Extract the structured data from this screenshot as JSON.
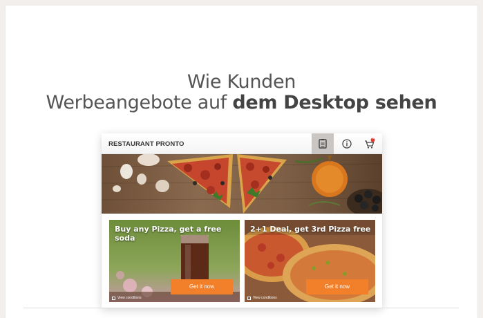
{
  "heading": {
    "line1": "Wie Kunden",
    "line2_regular": "Werbeangebote auf ",
    "line2_bold": "dem Desktop sehen"
  },
  "app": {
    "brand": "RESTAURANT PRONTO",
    "cart_count": "0",
    "icons": [
      "menu-list-icon",
      "info-icon",
      "cart-icon"
    ]
  },
  "offers": [
    {
      "title": "Buy any Pizza, get a free soda",
      "cta": "Get it now",
      "conditions": "View conditions"
    },
    {
      "title": "2+1 Deal, get 3rd Pizza free",
      "cta": "Get it now",
      "conditions": "View conditions"
    }
  ],
  "colors": {
    "accent": "#f27f29",
    "heading": "#555555",
    "background": "#f2efec"
  }
}
